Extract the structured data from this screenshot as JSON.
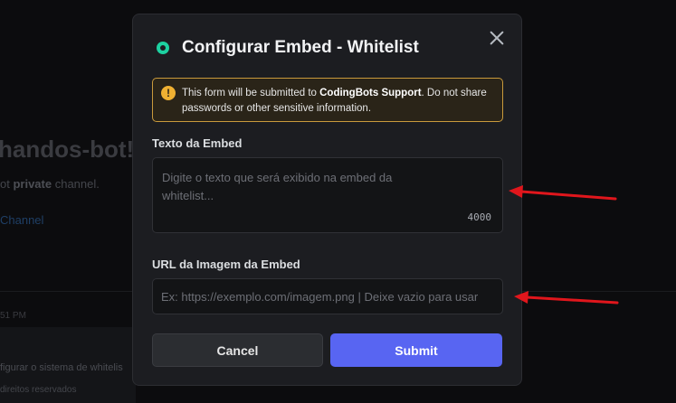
{
  "background": {
    "channel_title": "handos-bot!",
    "subtitle_prefix": "ot ",
    "subtitle_bold": "private",
    "subtitle_suffix": " channel.",
    "link": "Channel",
    "timestamp": "51 PM",
    "card_line1": "figurar o sistema de whitelis",
    "card_line2": "direitos reservados"
  },
  "modal": {
    "title": "Configurar Embed - Whitelist",
    "notice": {
      "text_before": "This form will be submitted to ",
      "bold": "CodingBots Support",
      "text_after": ". Do not share passwords or other sensitive information."
    },
    "fields": {
      "embed_text": {
        "label": "Texto da Embed",
        "placeholder": "Digite o texto que será exibido na embed da whitelist...",
        "value": "",
        "max_length": "4000"
      },
      "embed_image_url": {
        "label": "URL da Imagem da Embed",
        "placeholder": "Ex: https://exemplo.com/imagem.png | Deixe vazio para usar",
        "value": ""
      }
    },
    "buttons": {
      "cancel": "Cancel",
      "submit": "Submit"
    }
  },
  "colors": {
    "accent": "#5865f2",
    "warning_border": "#c99a3c",
    "annotation_arrow": "#e0161c"
  },
  "icons": {
    "bot": "bot-status-icon",
    "warning": "warning-icon",
    "close": "close-icon",
    "arrow": "annotation-arrow-icon"
  }
}
